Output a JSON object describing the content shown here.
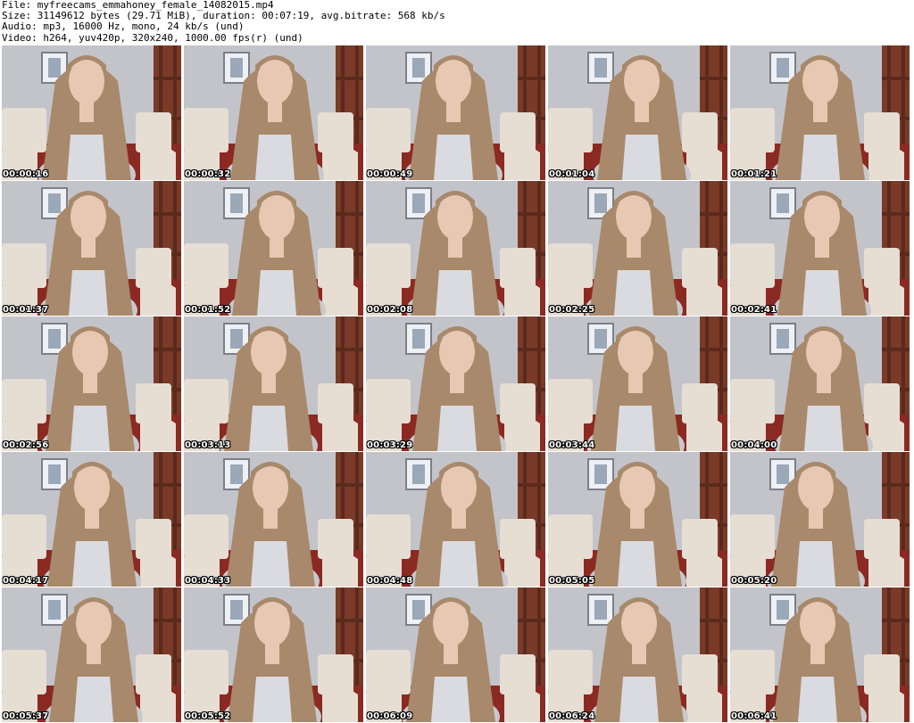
{
  "header": {
    "line1": "File: myfreecams_emmahoney_female_14082015.mp4",
    "line2": "Size: 31149612 bytes (29.71 MiB), duration: 00:07:19, avg.bitrate: 568 kb/s",
    "line3": "Audio: mp3, 16000 Hz, mono, 24 kb/s (und)",
    "line4": "Video: h264, yuv420p, 320x240, 1000.00 fps(r) (und)"
  },
  "thumbnails": [
    {
      "timestamp": "00:00:16"
    },
    {
      "timestamp": "00:00:32"
    },
    {
      "timestamp": "00:00:49"
    },
    {
      "timestamp": "00:01:04"
    },
    {
      "timestamp": "00:01:21"
    },
    {
      "timestamp": "00:01:37"
    },
    {
      "timestamp": "00:01:52"
    },
    {
      "timestamp": "00:02:08"
    },
    {
      "timestamp": "00:02:25"
    },
    {
      "timestamp": "00:02:41"
    },
    {
      "timestamp": "00:02:56"
    },
    {
      "timestamp": "00:03:13"
    },
    {
      "timestamp": "00:03:29"
    },
    {
      "timestamp": "00:03:44"
    },
    {
      "timestamp": "00:04:00"
    },
    {
      "timestamp": "00:04:17"
    },
    {
      "timestamp": "00:04:33"
    },
    {
      "timestamp": "00:04:48"
    },
    {
      "timestamp": "00:05:05"
    },
    {
      "timestamp": "00:05:20"
    },
    {
      "timestamp": "00:05:37"
    },
    {
      "timestamp": "00:05:52"
    },
    {
      "timestamp": "00:06:09"
    },
    {
      "timestamp": "00:06:24"
    },
    {
      "timestamp": "00:06:41"
    }
  ],
  "colors": {
    "wall": "#c3c4ca",
    "sofa": "#8a2a22",
    "pillow": "#e6ddd3",
    "hair": "#a8896b",
    "skin": "#e7c9b3",
    "shelf": "#7a3a28",
    "timestamp_text": "#ffffff"
  }
}
